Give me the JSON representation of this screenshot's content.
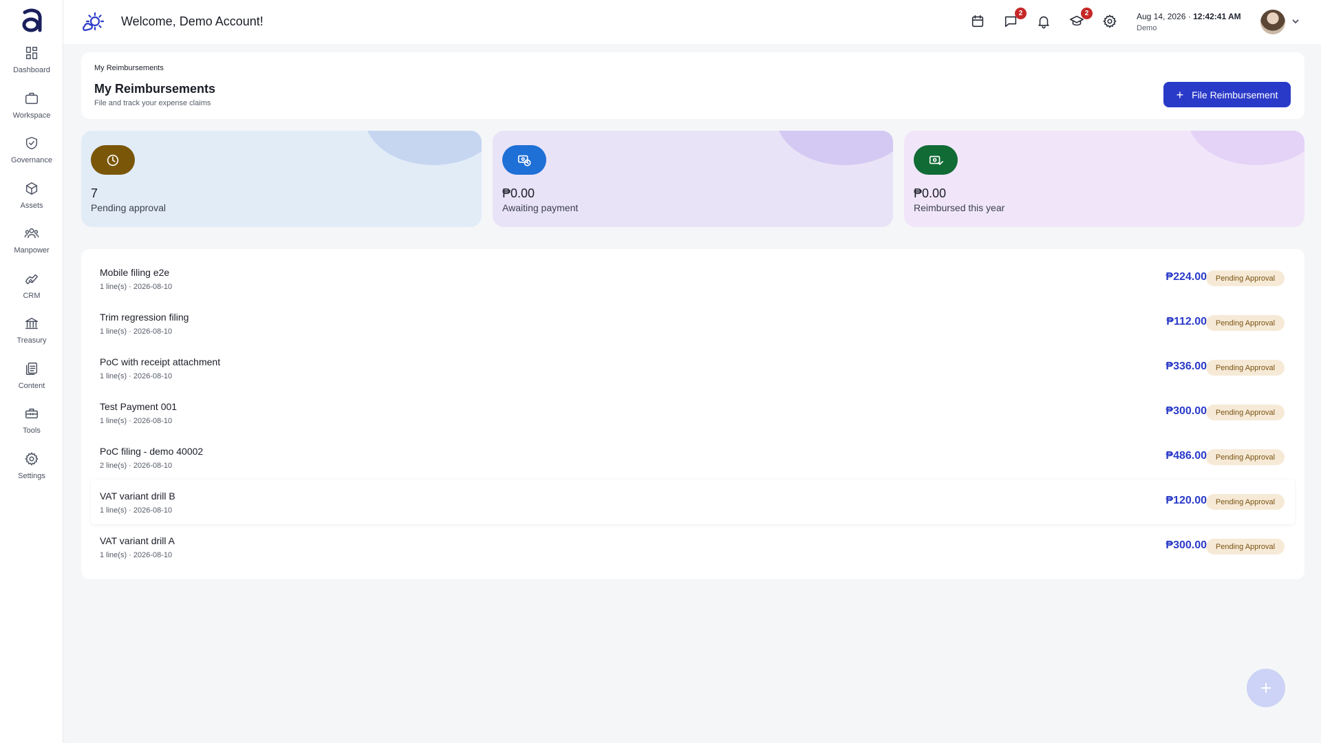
{
  "sidebar": {
    "items": [
      {
        "label": "Dashboard",
        "icon": "dashboard-icon"
      },
      {
        "label": "Workspace",
        "icon": "briefcase-icon"
      },
      {
        "label": "Governance",
        "icon": "shield-icon"
      },
      {
        "label": "Assets",
        "icon": "cube-icon"
      },
      {
        "label": "Manpower",
        "icon": "people-icon"
      },
      {
        "label": "CRM",
        "icon": "handshake-icon"
      },
      {
        "label": "Treasury",
        "icon": "bank-icon"
      },
      {
        "label": "Content",
        "icon": "document-icon"
      },
      {
        "label": "Tools",
        "icon": "toolbox-icon"
      },
      {
        "label": "Settings",
        "icon": "gear-icon"
      }
    ]
  },
  "header": {
    "welcome": "Welcome, Demo Account!",
    "messages_badge": "2",
    "learning_badge": "2",
    "date": "Aug 14, 2026",
    "separator": "·",
    "time": "12:42:41 AM",
    "account": "Demo"
  },
  "page": {
    "breadcrumb": "My Reimbursements",
    "title": "My Reimbursements",
    "subtitle": "File and track your expense claims",
    "file_button": "File Reimbursement"
  },
  "stats": [
    {
      "value": "7",
      "caption": "Pending approval",
      "bg": "#e2ecf7",
      "blob": "#c6d6f1",
      "icon_bg": "#7a5608",
      "icon": "clock-icon"
    },
    {
      "value": "₱0.00",
      "caption": "Awaiting payment",
      "bg": "#e9e3f7",
      "blob": "#d4c9f3",
      "icon_bg": "#1e6fd6",
      "icon": "payment-pending-icon"
    },
    {
      "value": "₱0.00",
      "caption": "Reimbursed this year",
      "bg": "#f1e6f9",
      "blob": "#e4d3f6",
      "icon_bg": "#116b35",
      "icon": "cash-check-icon"
    }
  ],
  "reimbursements": [
    {
      "title": "Mobile filing e2e",
      "meta": "1 line(s) · 2026-08-10",
      "amount": "₱224.00",
      "status": "Pending Approval"
    },
    {
      "title": "Trim regression filing",
      "meta": "1 line(s) · 2026-08-10",
      "amount": "₱112.00",
      "status": "Pending Approval"
    },
    {
      "title": "PoC with receipt attachment",
      "meta": "1 line(s) · 2026-08-10",
      "amount": "₱336.00",
      "status": "Pending Approval"
    },
    {
      "title": "Test Payment 001",
      "meta": "1 line(s) · 2026-08-10",
      "amount": "₱300.00",
      "status": "Pending Approval"
    },
    {
      "title": "PoC filing - demo 40002",
      "meta": "2 line(s) · 2026-08-10",
      "amount": "₱486.00",
      "status": "Pending Approval"
    },
    {
      "title": "VAT variant drill B",
      "meta": "1 line(s) · 2026-08-10",
      "amount": "₱120.00",
      "status": "Pending Approval"
    },
    {
      "title": "VAT variant drill A",
      "meta": "1 line(s) · 2026-08-10",
      "amount": "₱300.00",
      "status": "Pending Approval"
    }
  ],
  "colors": {
    "accent": "#2a3ac8",
    "status_bg": "#f6ead7",
    "status_text": "#7a5312",
    "badge": "#c62828"
  }
}
